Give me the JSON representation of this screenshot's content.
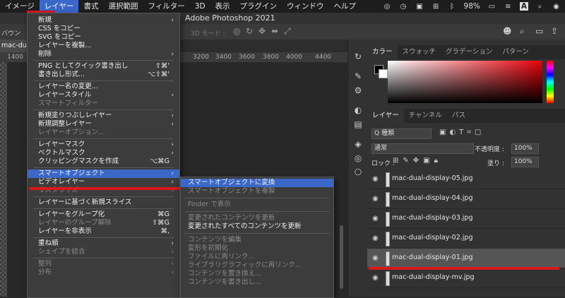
{
  "menubar": {
    "items": [
      "イメージ",
      "レイヤー",
      "書式",
      "選択範囲",
      "フィルター",
      "3D",
      "表示",
      "プラグイン",
      "ウィンドウ",
      "ヘルプ"
    ],
    "active_index": 1,
    "battery": "98%",
    "input_indicator": "A"
  },
  "window": {
    "title": "Adobe Photoshop 2021"
  },
  "options": {
    "left_label": "バウン",
    "mode3d": "3D モード :"
  },
  "document": {
    "tab": "mac-dual-"
  },
  "ruler": {
    "left": "1400",
    "ticks": [
      "3200",
      "3400",
      "3600",
      "3800",
      "4000",
      "4400"
    ]
  },
  "layer_menu": {
    "items": [
      {
        "label": "新規",
        "arrow": true
      },
      {
        "label": "CSS をコピー"
      },
      {
        "label": "SVG をコピー"
      },
      {
        "label": "レイヤーを複製..."
      },
      {
        "label": "削除",
        "arrow": true
      },
      {
        "sep": true
      },
      {
        "label": "PNG としてクイック書き出し",
        "shortcut": "⇧⌘'"
      },
      {
        "label": "書き出し形式...",
        "shortcut": "⌥⇧⌘'"
      },
      {
        "sep": true
      },
      {
        "label": "レイヤー名の変更..."
      },
      {
        "label": "レイヤースタイル",
        "arrow": true
      },
      {
        "label": "スマートフィルター",
        "disabled": true
      },
      {
        "sep": true
      },
      {
        "label": "新規塗りつぶしレイヤー",
        "arrow": true
      },
      {
        "label": "新規調整レイヤー",
        "arrow": true
      },
      {
        "label": "レイヤーオプション...",
        "disabled": true
      },
      {
        "sep": true
      },
      {
        "label": "レイヤーマスク",
        "arrow": true
      },
      {
        "label": "ベクトルマスク",
        "arrow": true
      },
      {
        "label": "クリッピングマスクを作成",
        "shortcut": "⌥⌘G"
      },
      {
        "sep": true
      },
      {
        "label": "スマートオブジェクト",
        "arrow": true,
        "highlighted": true
      },
      {
        "label": "ビデオレイヤー",
        "arrow": true
      },
      {
        "label": "ラスタライズ",
        "arrow": true,
        "disabled": true
      },
      {
        "sep": true
      },
      {
        "label": "レイヤーに基づく新規スライス"
      },
      {
        "sep": true
      },
      {
        "label": "レイヤーをグループ化",
        "shortcut": "⌘G"
      },
      {
        "label": "レイヤーのグループ解除",
        "shortcut": "⇧⌘G",
        "disabled": true
      },
      {
        "label": "レイヤーを非表示",
        "shortcut": "⌘,"
      },
      {
        "sep": true
      },
      {
        "label": "重ね順",
        "arrow": true
      },
      {
        "label": "シェイプを結合",
        "arrow": true,
        "disabled": true
      },
      {
        "sep": true
      },
      {
        "label": "整列",
        "arrow": true,
        "disabled": true
      },
      {
        "label": "分布",
        "arrow": true,
        "disabled": true
      }
    ]
  },
  "smart_object_menu": {
    "items": [
      {
        "label": "スマートオブジェクトに変換",
        "highlighted": true
      },
      {
        "label": "スマートオブジェクトを複製",
        "disabled": true
      },
      {
        "sep": true
      },
      {
        "label": "Finder で表示",
        "disabled": true
      },
      {
        "sep": true
      },
      {
        "label": "変更されたコンテンツを更新",
        "disabled": true
      },
      {
        "label": "変更されたすべてのコンテンツを更新"
      },
      {
        "sep": true
      },
      {
        "label": "コンテンツを編集",
        "disabled": true
      },
      {
        "label": "変形を初期化",
        "disabled": true
      },
      {
        "label": "ファイルに再リンク...",
        "disabled": true
      },
      {
        "label": "ライブラリグラフィックに再リンク...",
        "disabled": true
      },
      {
        "label": "コンテンツを置き換え...",
        "disabled": true
      },
      {
        "label": "コンテンツを書き出し...",
        "disabled": true
      }
    ]
  },
  "color_panel": {
    "tabs": [
      "カラー",
      "スウォッチ",
      "グラデーション",
      "パターン"
    ]
  },
  "layers_panel": {
    "tabs": [
      "レイヤー",
      "チャンネル",
      "パス"
    ],
    "filter": "Q 種類",
    "blend_mode": "通常",
    "opacity_label": "不透明度 :",
    "opacity": "100%",
    "lock_label": "ロック :",
    "fill_label": "塗り :",
    "fill": "100%",
    "layers": [
      {
        "name": "mac-dual-display-05.jpg"
      },
      {
        "name": "mac-dual-display-04.jpg"
      },
      {
        "name": "mac-dual-display-03.jpg"
      },
      {
        "name": "mac-dual-display-02.jpg"
      },
      {
        "name": "mac-dual-display-01.jpg",
        "selected": true
      },
      {
        "name": "mac-dual-display-mv.jpg"
      }
    ]
  },
  "colors": {
    "highlight": "#3a67c8",
    "annotation_red": "#d8191b"
  }
}
